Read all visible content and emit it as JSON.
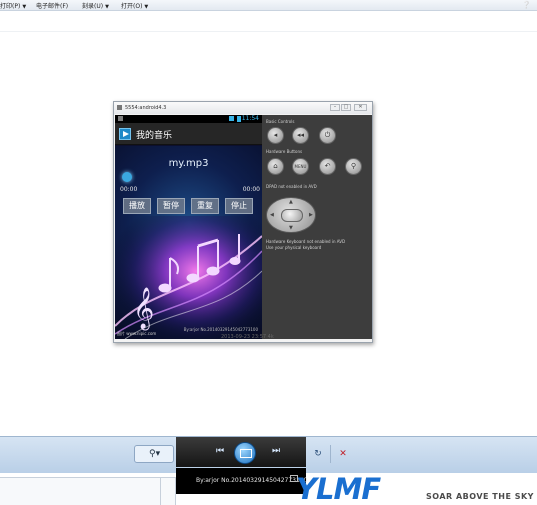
{
  "menu": {
    "items": [
      {
        "label": "打印(P)"
      },
      {
        "label": "电子邮件(F)"
      },
      {
        "label": "刻录(U)"
      },
      {
        "label": "打开(O)"
      }
    ]
  },
  "emulator": {
    "title": "5554:android4.3",
    "status_time": "11:54",
    "app_title": "我的音乐",
    "song": "my.mp3",
    "time_elapsed": "00:00",
    "time_total": "00:00",
    "buttons": [
      {
        "label": "播放"
      },
      {
        "label": "暂停"
      },
      {
        "label": "重复"
      },
      {
        "label": "停止"
      }
    ],
    "watermark": "图片 www.nipic.com",
    "watermark2": "By:arjor No.20140329145042773100",
    "panel": {
      "basic_controls": "Basic Controls",
      "hardware_buttons": "Hardware Buttons",
      "dpad_label": "DPAD not enabled in AVD",
      "keyboard_label": "Hardware Keyboard not enabled in AVD",
      "keyboard_note": "Use your physical keyboard"
    }
  },
  "below_text": "2013-09-23  23:57  4k",
  "tooltip": "By:arjor No.20140329145042773100",
  "logo": {
    "text": "YLMF",
    "tagline": "SOAR ABOVE THE SKY"
  },
  "colors": {
    "toolbar": "#b9cfe7",
    "accent": "#1a6fd0",
    "emulator_panel": "#3d3d3d"
  }
}
